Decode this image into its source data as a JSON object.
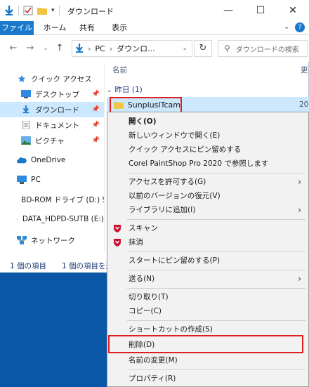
{
  "window": {
    "title": "ダウンロード",
    "controls": {
      "minimize": "—",
      "maximize": "☐",
      "close": "✕"
    }
  },
  "ribbon": {
    "tabs": [
      "ファイル",
      "ホーム",
      "共有",
      "表示"
    ]
  },
  "address": {
    "path_pc": "PC",
    "path_sep": "›",
    "path_folder": "ダウンロ...",
    "search_placeholder": "ダウンロードの検索"
  },
  "nav": {
    "items": [
      {
        "label": "クイック アクセス",
        "icon": "star-icon"
      },
      {
        "label": "デスクトップ",
        "icon": "desktop-icon"
      },
      {
        "label": "ダウンロード",
        "icon": "download-icon"
      },
      {
        "label": "ドキュメント",
        "icon": "document-icon"
      },
      {
        "label": "ピクチャ",
        "icon": "picture-icon"
      },
      {
        "label": "OneDrive",
        "icon": "cloud-icon"
      },
      {
        "label": "PC",
        "icon": "pc-icon"
      },
      {
        "label": "BD-ROM ドライブ (D:) S",
        "icon": "disc-icon"
      },
      {
        "label": "DATA_HDPD-SUTB (E:)",
        "icon": "drive-icon"
      },
      {
        "label": "ネットワーク",
        "icon": "network-icon"
      }
    ]
  },
  "content": {
    "column_name": "名前",
    "column_date": "更",
    "group_label": "昨日 (1)",
    "file_name": "SunplusITcam",
    "file_date": "20"
  },
  "status": {
    "count": "1 個の項目",
    "selected": "1 個の項目を選"
  },
  "context_menu": {
    "items": [
      "開く(O)",
      "新しいウィンドウで開く(E)",
      "クイック アクセスにピン留めする",
      "Corel PaintShop Pro 2020 で参照します",
      "アクセスを許可する(G)",
      "以前のバージョンの復元(V)",
      "ライブラリに追加(I)",
      "スキャン",
      "抹消",
      "スタートにピン留めする(P)",
      "送る(N)",
      "切り取り(T)",
      "コピー(C)",
      "ショートカットの作成(S)",
      "削除(D)",
      "名前の変更(M)",
      "プロパティ(R)"
    ]
  },
  "colors": {
    "accent": "#1979ca",
    "selection": "#cce8ff",
    "highlight_border": "#e02020",
    "desktop": "#0a57a8"
  }
}
